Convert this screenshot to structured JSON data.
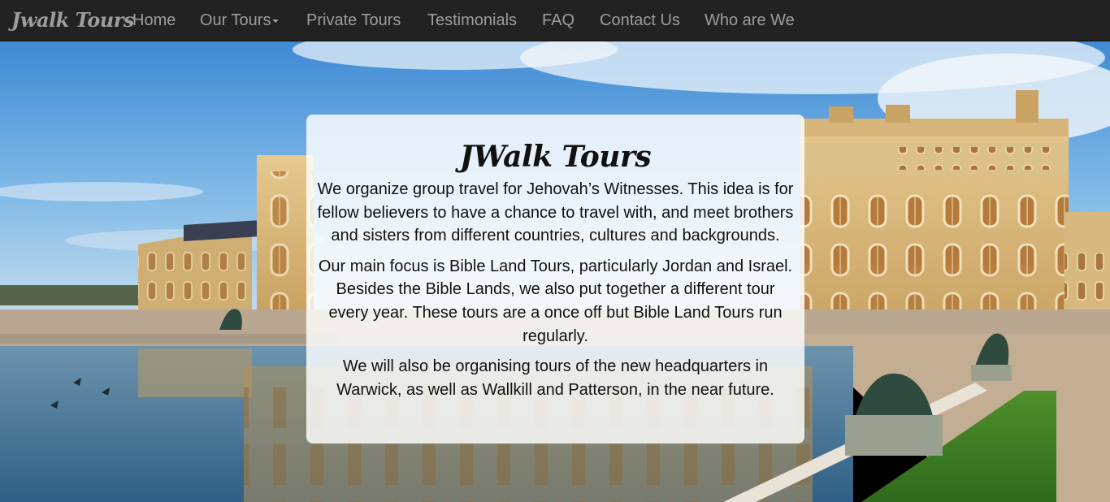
{
  "nav": {
    "brand": "Jwalk Tours",
    "items": [
      {
        "label": "Home"
      },
      {
        "label": "Our Tours"
      },
      {
        "label": "Private Tours"
      },
      {
        "label": "Testimonials"
      },
      {
        "label": "FAQ"
      },
      {
        "label": "Contact Us"
      },
      {
        "label": "Who are We"
      }
    ]
  },
  "hero": {
    "image_alt": "Palace of Versailles reflected in a pool",
    "colors": {
      "sky": "#5aa6e0",
      "stone": "#d9b97c",
      "water": "#4f7fa0",
      "lawn": "#3d7a27",
      "navbar": "#222222"
    }
  },
  "intro": {
    "title": "JWalk Tours",
    "paragraphs": [
      "We organize group travel for Jehovah’s Witnesses. This idea is for fellow believers to have a chance to travel with, and meet brothers and sisters from different countries, cultures and backgrounds.",
      "Our main focus is Bible Land Tours, particularly Jordan and Israel. Besides the Bible Lands, we also put together a different tour every year. These tours are a once off but Bible Land Tours run regularly.",
      "We will also be organising tours of the new headquarters in Warwick, as well as Wallkill and Patterson, in the near future."
    ]
  }
}
